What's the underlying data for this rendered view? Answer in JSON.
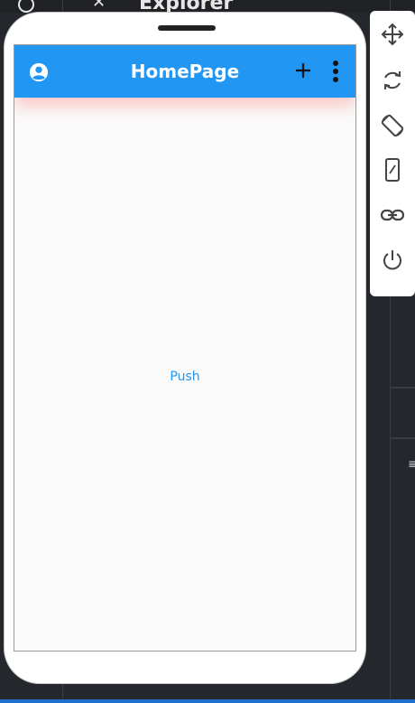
{
  "ide": {
    "panel_title": "Explorer",
    "menu_glyph": "≡"
  },
  "app": {
    "title": "HomePage",
    "push_label": "Push",
    "appbar_color": "#2196f3",
    "background_color": "#fafafa"
  },
  "icons": {
    "account": "account-circle-icon",
    "add": "plus-icon",
    "more": "more-vertical-icon",
    "move": "move-icon",
    "rotate": "rotate-icon",
    "orientation": "screen-rotation-icon",
    "device": "device-frame-icon",
    "link": "link-icon",
    "power": "power-icon"
  }
}
